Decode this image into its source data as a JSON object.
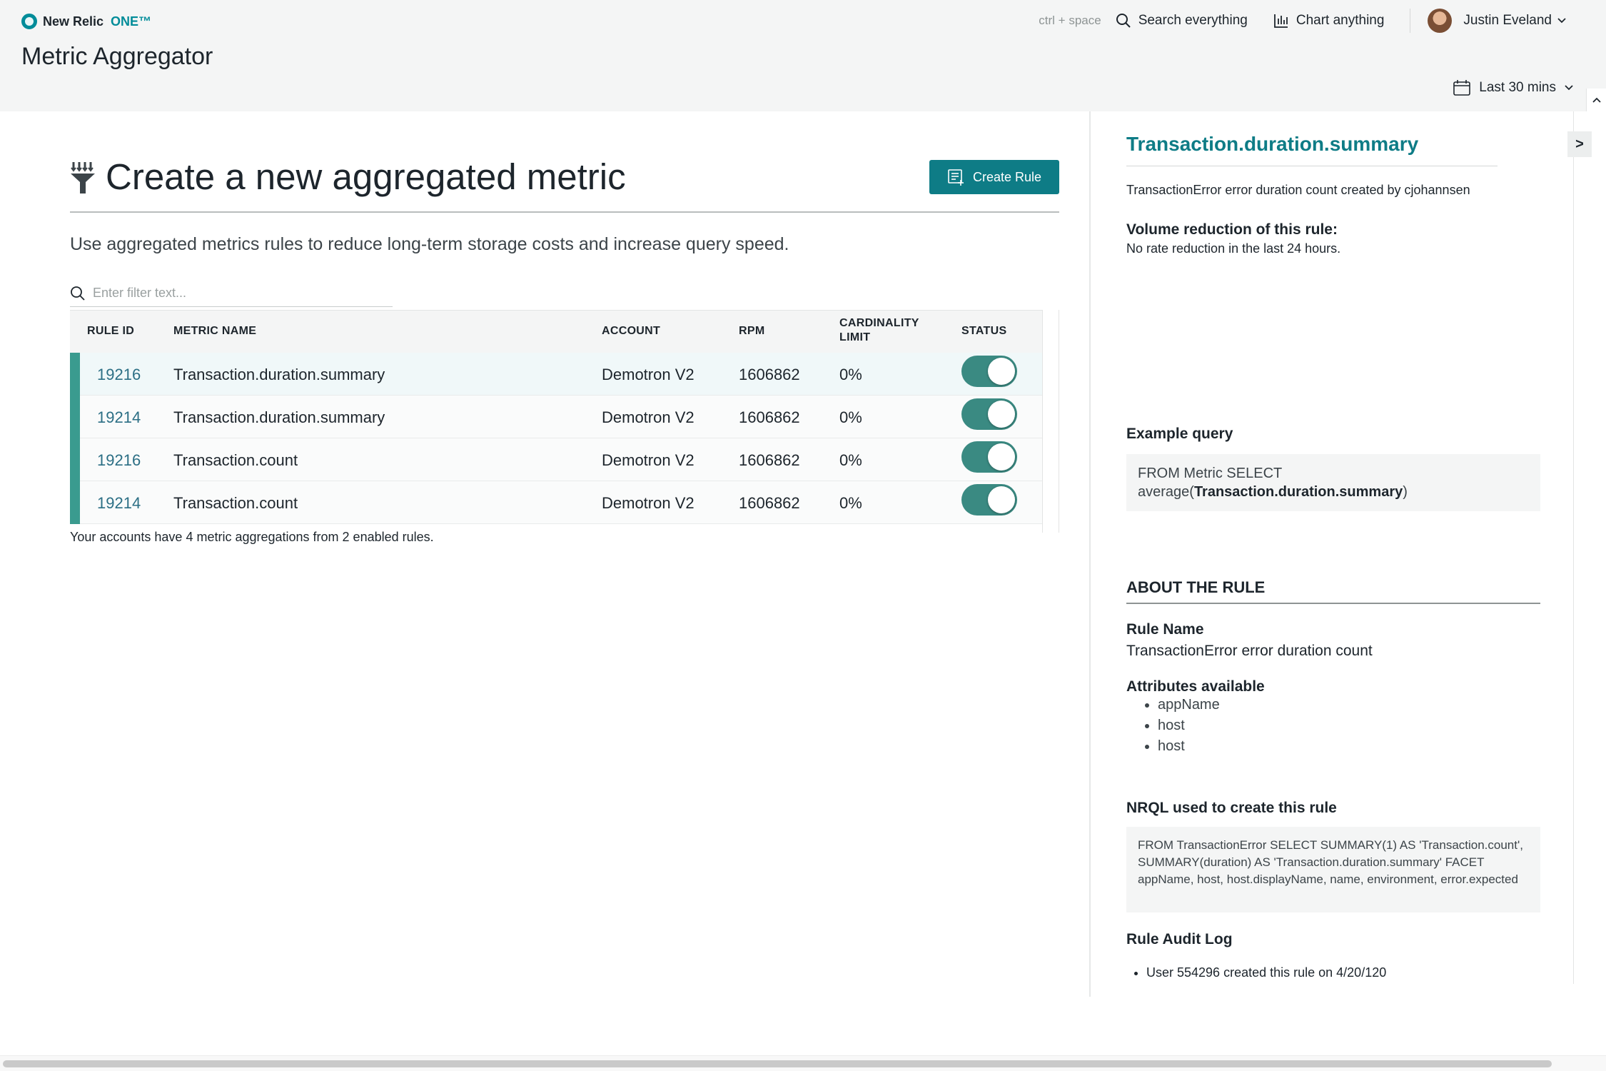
{
  "header": {
    "brand_name": "New Relic",
    "brand_suffix": "ONE™",
    "page_title": "Metric Aggregator",
    "shortcut_hint": "ctrl + space",
    "search_label": "Search everything",
    "chart_label": "Chart anything",
    "user_name": "Justin Eveland",
    "time_range": "Last 30 mins"
  },
  "main": {
    "heading": "Create a new aggregated metric",
    "create_button_label": "Create Rule",
    "intro": "Use aggregated metrics rules to reduce long-term storage costs and increase query speed.",
    "filter_placeholder": "Enter filter text...",
    "columns": [
      "RULE ID",
      "METRIC NAME",
      "ACCOUNT",
      "RPM",
      "CARDINALITY LIMIT",
      "STATUS"
    ],
    "rows": [
      {
        "rule_id": "19216",
        "metric_name": "Transaction.duration.summary",
        "account": "Demotron V2",
        "rpm": "1606862",
        "cardinality": "0%",
        "enabled": true
      },
      {
        "rule_id": "19214",
        "metric_name": "Transaction.duration.summary",
        "account": "Demotron V2",
        "rpm": "1606862",
        "cardinality": "0%",
        "enabled": true
      },
      {
        "rule_id": "19216",
        "metric_name": "Transaction.count",
        "account": "Demotron V2",
        "rpm": "1606862",
        "cardinality": "0%",
        "enabled": true
      },
      {
        "rule_id": "19214",
        "metric_name": "Transaction.count",
        "account": "Demotron V2",
        "rpm": "1606862",
        "cardinality": "0%",
        "enabled": true
      }
    ],
    "summary": "Your accounts have 4 metric aggregations from 2 enabled rules."
  },
  "panel": {
    "collapse_label": ">",
    "metric_title": "Transaction.duration.summary",
    "subtitle": "TransactionError error duration count created by cjohannsen",
    "volume_heading": "Volume reduction of this rule:",
    "volume_text": "No rate reduction in the last 24 hours.",
    "example_heading": "Example query",
    "example_query_prefix": "FROM Metric SELECT average(",
    "example_query_metric": "Transaction.duration.summary",
    "example_query_suffix": ")",
    "about_heading": "ABOUT THE RULE",
    "rule_name_label": "Rule Name",
    "rule_name": "TransactionError error duration count",
    "attributes_label": "Attributes available",
    "attributes": [
      "appName",
      "host",
      "host"
    ],
    "nrql_label": "NRQL used to create this rule",
    "nrql": "FROM TransactionError SELECT SUMMARY(1) AS 'Transaction.count', SUMMARY(duration) AS 'Transaction.duration.summary' FACET appName, host, host.displayName, name, environment, error.expected",
    "audit_label": "Rule Audit Log",
    "audit_entries": [
      "User 554296 created this rule on 4/20/120"
    ]
  },
  "colors": {
    "accent": "#0e7c86",
    "toggle_on": "#3a8a82",
    "row_marker": "#3a9b8f",
    "link": "#2c6f85"
  },
  "icons": [
    "brand-logo-icon",
    "search-icon",
    "chart-icon",
    "chevron-down-icon",
    "calendar-icon",
    "chevron-up-icon",
    "aggregate-funnel-icon",
    "create-rule-icon"
  ]
}
